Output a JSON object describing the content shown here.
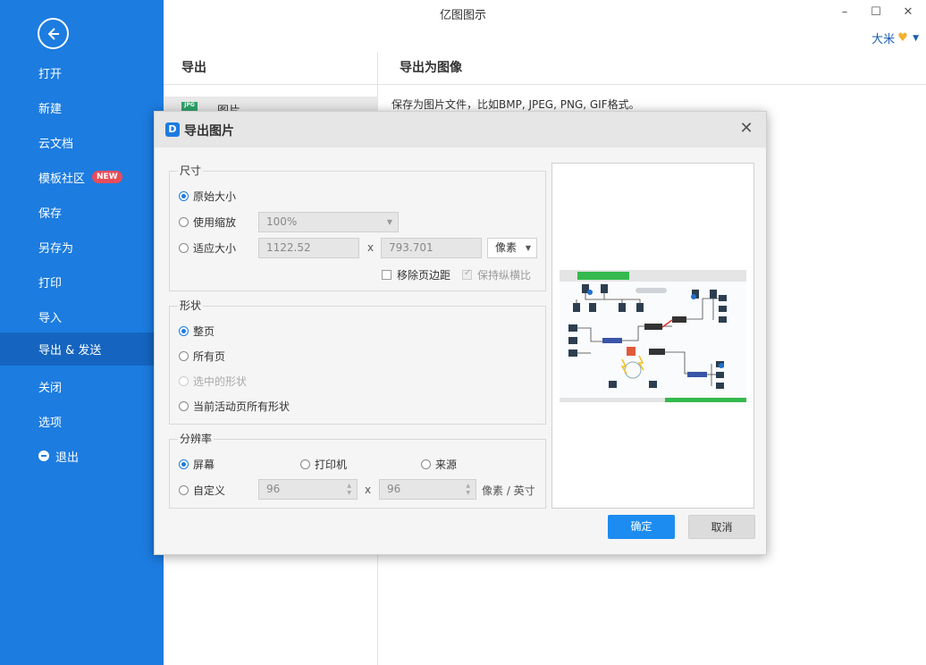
{
  "window": {
    "title": "亿图图示",
    "minimize": "–",
    "maximize": "☐",
    "close": "✕",
    "user_name": "大米"
  },
  "sidebar": {
    "items": [
      {
        "label": "打开"
      },
      {
        "label": "新建"
      },
      {
        "label": "云文档"
      },
      {
        "label": "模板社区",
        "badge": "NEW"
      },
      {
        "label": "保存"
      },
      {
        "label": "另存为"
      },
      {
        "label": "打印"
      },
      {
        "label": "导入"
      },
      {
        "label": "导出 & 发送",
        "active": true
      },
      {
        "label": "关闭"
      },
      {
        "label": "选项"
      },
      {
        "label": "退出"
      }
    ]
  },
  "export_panel": {
    "heading": "导出",
    "selected_item": "图片",
    "selected_icon": "JPG",
    "right_heading": "导出为图像",
    "right_description": "保存为图片文件，比如BMP, JPEG, PNG, GIF格式。"
  },
  "dialog": {
    "title": "导出图片",
    "logo_text": "D",
    "size_group": {
      "title": "尺寸",
      "original": "原始大小",
      "use_scale": "使用缩放",
      "scale_value": "100%",
      "fit_size": "适应大小",
      "width": "1122.52",
      "height": "793.701",
      "x_sep": "x",
      "unit": "像素",
      "remove_margin": "移除页边距",
      "keep_ratio": "保持纵横比"
    },
    "shape_group": {
      "title": "形状",
      "whole_page": "整页",
      "all_pages": "所有页",
      "selected_shapes": "选中的形状",
      "current_page_shapes": "当前活动页所有形状"
    },
    "resolution_group": {
      "title": "分辨率",
      "screen": "屏幕",
      "printer": "打印机",
      "source": "来源",
      "custom": "自定义",
      "dpi_x": "96",
      "dpi_y": "96",
      "x_sep": "x",
      "unit": "像素 / 英寸"
    },
    "ok": "确定",
    "cancel": "取消"
  },
  "colors": {
    "sidebar": "#1c7ce0",
    "sidebar_active": "#1565c0",
    "primary_button": "#1c8cf0"
  }
}
